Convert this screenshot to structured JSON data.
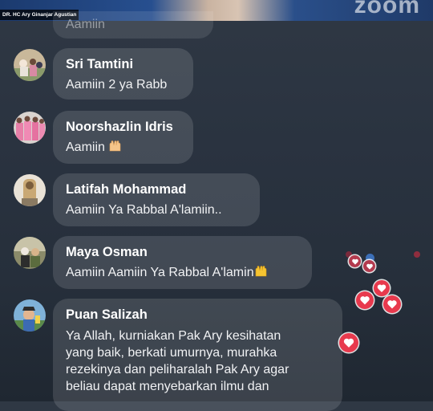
{
  "video": {
    "presenter_label": "DR. HC Ary Ginanjar Agustian",
    "watermark": "zoom"
  },
  "previous_comment": {
    "text": "Aamiin"
  },
  "comments": [
    {
      "name": "Sri Tamtini",
      "text": "Aamiin 2 ya Rabb"
    },
    {
      "name": "Noorshazlin Idris",
      "text": "Aamiin",
      "emoji": "raised-hands-icon"
    },
    {
      "name": "Latifah Mohammad",
      "text": "Aamiin Ya Rabbal A'lamiin.."
    },
    {
      "name": "Maya Osman",
      "text": "Aamiin Aamiin Ya Rabbal A'lamin",
      "emoji": "raised-hands-icon"
    },
    {
      "name": "Puan Salizah",
      "text_lines": [
        "Ya Allah, kurniakan Pak Ary kesihatan",
        "yang baik, berkati umurnya, murahka",
        "rezekinya dan peliharalah Pak Ary agar",
        "beliau dapat menyebarkan ilmu dan"
      ]
    }
  ],
  "reactions": {
    "icon": "heart-icon",
    "color": "#e8394d"
  }
}
